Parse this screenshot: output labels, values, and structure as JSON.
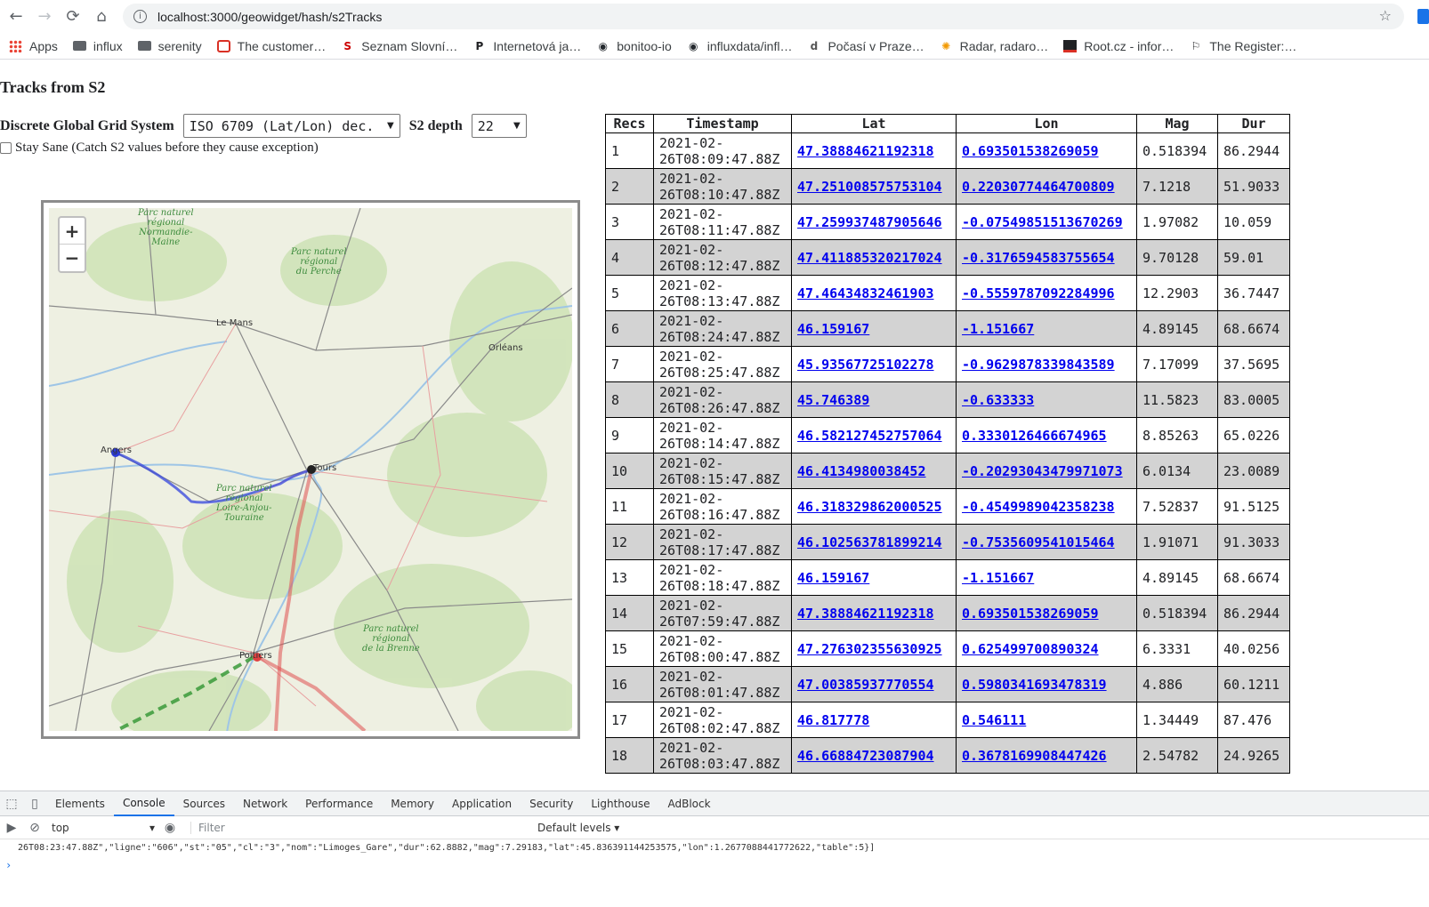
{
  "browser": {
    "url": "localhost:3000/geowidget/hash/s2Tracks",
    "bookmarks": [
      {
        "label": "Apps",
        "icon": "apps"
      },
      {
        "label": "influx",
        "icon": "folder"
      },
      {
        "label": "serenity",
        "icon": "folder"
      },
      {
        "label": "The customer…",
        "icon": "red"
      },
      {
        "label": "Seznam Slovní…",
        "icon": "seznam"
      },
      {
        "label": "Internetová ja…",
        "icon": "p"
      },
      {
        "label": "bonitoo-io",
        "icon": "gh"
      },
      {
        "label": "influxdata/infl…",
        "icon": "gh"
      },
      {
        "label": "Počasí v Praze…",
        "icon": "pocasi"
      },
      {
        "label": "Radar, radaro…",
        "icon": "radar"
      },
      {
        "label": "Root.cz - infor…",
        "icon": "root"
      },
      {
        "label": "The Register:…",
        "icon": "reg"
      }
    ]
  },
  "page": {
    "title": "Tracks from S2",
    "dggs_label": "Discrete Global Grid System",
    "dggs_value": "ISO 6709 (Lat/Lon) dec.",
    "depth_label": "S2 depth",
    "depth_value": "22",
    "stay_sane_label": "Stay Sane (Catch S2 values before they cause exception)"
  },
  "map": {
    "zoom_in": "+",
    "zoom_out": "−",
    "cities": [
      "Le Mans",
      "Orléans",
      "Angers",
      "Tours",
      "Poitiers"
    ],
    "parks": [
      "Parc naturel\nrégional\nNormandie-\nMaine",
      "Parc naturel\nrégional\ndu Perche",
      "Parc naturel\nrégional\nLoire-Anjou-\nTouraine",
      "Parc naturel\nrégional\nde la Brenne"
    ]
  },
  "table": {
    "headers": [
      "Recs",
      "Timestamp",
      "Lat",
      "Lon",
      "Mag",
      "Dur"
    ],
    "rows": [
      {
        "rec": "1",
        "ts": "2021-02-\n26T08:09:47.88Z",
        "lat": "47.38884621192318",
        "lon": "0.693501538269059",
        "mag": "0.518394",
        "dur": "86.2944"
      },
      {
        "rec": "2",
        "ts": "2021-02-\n26T08:10:47.88Z",
        "lat": "47.251008575753104",
        "lon": "0.22030774464700809",
        "mag": "7.1218",
        "dur": "51.9033"
      },
      {
        "rec": "3",
        "ts": "2021-02-\n26T08:11:47.88Z",
        "lat": "47.259937487905646",
        "lon": "-0.07549851513670269",
        "mag": "1.97082",
        "dur": "10.059"
      },
      {
        "rec": "4",
        "ts": "2021-02-\n26T08:12:47.88Z",
        "lat": "47.411885320217024",
        "lon": "-0.3176594583755654",
        "mag": "9.70128",
        "dur": "59.01"
      },
      {
        "rec": "5",
        "ts": "2021-02-\n26T08:13:47.88Z",
        "lat": "47.46434832461903",
        "lon": "-0.5559787092284996",
        "mag": "12.2903",
        "dur": "36.7447"
      },
      {
        "rec": "6",
        "ts": "2021-02-\n26T08:24:47.88Z",
        "lat": "46.159167",
        "lon": "-1.151667",
        "mag": "4.89145",
        "dur": "68.6674"
      },
      {
        "rec": "7",
        "ts": "2021-02-\n26T08:25:47.88Z",
        "lat": "45.93567725102278",
        "lon": "-0.9629878339843589",
        "mag": "7.17099",
        "dur": "37.5695"
      },
      {
        "rec": "8",
        "ts": "2021-02-\n26T08:26:47.88Z",
        "lat": "45.746389",
        "lon": "-0.633333",
        "mag": "11.5823",
        "dur": "83.0005"
      },
      {
        "rec": "9",
        "ts": "2021-02-\n26T08:14:47.88Z",
        "lat": "46.582127452757064",
        "lon": "0.3330126466674965",
        "mag": "8.85263",
        "dur": "65.0226"
      },
      {
        "rec": "10",
        "ts": "2021-02-\n26T08:15:47.88Z",
        "lat": "46.4134980038452",
        "lon": "-0.20293043479971073",
        "mag": "6.0134",
        "dur": "23.0089"
      },
      {
        "rec": "11",
        "ts": "2021-02-\n26T08:16:47.88Z",
        "lat": "46.318329862000525",
        "lon": "-0.4549989042358238",
        "mag": "7.52837",
        "dur": "91.5125"
      },
      {
        "rec": "12",
        "ts": "2021-02-\n26T08:17:47.88Z",
        "lat": "46.102563781899214",
        "lon": "-0.7535609541015464",
        "mag": "1.91071",
        "dur": "91.3033"
      },
      {
        "rec": "13",
        "ts": "2021-02-\n26T08:18:47.88Z",
        "lat": "46.159167",
        "lon": "-1.151667",
        "mag": "4.89145",
        "dur": "68.6674"
      },
      {
        "rec": "14",
        "ts": "2021-02-\n26T07:59:47.88Z",
        "lat": "47.38884621192318",
        "lon": "0.693501538269059",
        "mag": "0.518394",
        "dur": "86.2944"
      },
      {
        "rec": "15",
        "ts": "2021-02-\n26T08:00:47.88Z",
        "lat": "47.276302355630925",
        "lon": "0.625499700890324",
        "mag": "6.3331",
        "dur": "40.0256"
      },
      {
        "rec": "16",
        "ts": "2021-02-\n26T08:01:47.88Z",
        "lat": "47.00385937770554",
        "lon": "0.5980341693478319",
        "mag": "4.886",
        "dur": "60.1211"
      },
      {
        "rec": "17",
        "ts": "2021-02-\n26T08:02:47.88Z",
        "lat": "46.817778",
        "lon": "0.546111",
        "mag": "1.34449",
        "dur": "87.476"
      },
      {
        "rec": "18",
        "ts": "2021-02-\n26T08:03:47.88Z",
        "lat": "46.66884723087904",
        "lon": "0.3678169908447426",
        "mag": "2.54782",
        "dur": "24.9265"
      }
    ]
  },
  "devtools": {
    "tabs": [
      "Elements",
      "Console",
      "Sources",
      "Network",
      "Performance",
      "Memory",
      "Application",
      "Security",
      "Lighthouse",
      "AdBlock"
    ],
    "active_tab": "Console",
    "context": "top",
    "filter_placeholder": "Filter",
    "levels": "Default levels ▾",
    "console_line": "26T08:23:47.88Z\",\"ligne\":\"606\",\"st\":\"05\",\"cl\":\"3\",\"nom\":\"Limoges_Gare\",\"dur\":62.8882,\"mag\":7.29183,\"lat\":45.836391144253575,\"lon\":1.2677088441772622,\"table\":5}]"
  }
}
